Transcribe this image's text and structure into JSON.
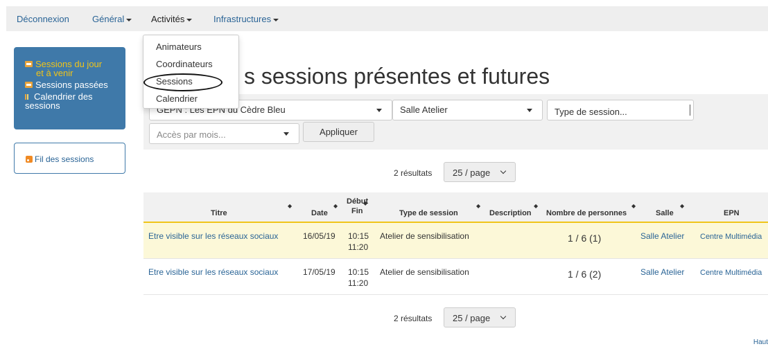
{
  "navbar": {
    "items": [
      {
        "label": "Déconnexion"
      },
      {
        "label": "Général"
      },
      {
        "label": "Activités"
      },
      {
        "label": "Infrastructures"
      }
    ]
  },
  "dropdown": {
    "items": [
      "Animateurs",
      "Coordinateurs",
      "Sessions",
      "Calendrier"
    ]
  },
  "sidebar": {
    "sessions_today_line1": "Sessions du jour",
    "sessions_today_line2": "et à venir",
    "sessions_past": "Sessions passées",
    "calendar_line1": "Calendrier des",
    "calendar_line2": "sessions",
    "feed": "Fil des sessions"
  },
  "page": {
    "title_visible": "s sessions présentes et futures"
  },
  "filters": {
    "epn_value": "GEPN : Les EPN du Cèdre Bleu",
    "salle_value": "Salle Atelier",
    "type_placeholder": "Type de session...",
    "month_placeholder": "Accès par mois...",
    "apply_label": "Appliquer"
  },
  "pagination": {
    "count": "2 résultats",
    "per_page": "25 / page"
  },
  "table": {
    "headers": {
      "titre": "Titre",
      "date": "Date",
      "debut": "Début",
      "fin": "Fin",
      "type": "Type de session",
      "description": "Description",
      "nombre": "Nombre de personnes",
      "salle": "Salle",
      "epn": "EPN"
    },
    "rows": [
      {
        "titre": "Etre visible sur les réseaux sociaux",
        "date": "16/05/19",
        "debut": "10:15",
        "fin": "11:20",
        "type": "Atelier de sensibilisation",
        "description": "",
        "nombre": "1 / 6 (1)",
        "salle": "Salle Atelier",
        "epn": "Centre Multimédia"
      },
      {
        "titre": "Etre visible sur les réseaux sociaux",
        "date": "17/05/19",
        "debut": "10:15",
        "fin": "11:20",
        "type": "Atelier de sensibilisation",
        "description": "",
        "nombre": "1 / 6 (2)",
        "salle": "Salle Atelier",
        "epn": "Centre Multimédia"
      }
    ]
  },
  "footer": {
    "haut": "Haut"
  },
  "colors": {
    "accent": "#2a6496",
    "sidebar_bg": "#3f79a9",
    "highlight_row": "#fcf8d8",
    "header_border": "#f0c419"
  }
}
